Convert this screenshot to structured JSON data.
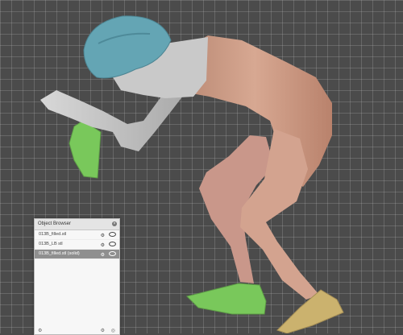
{
  "object_browser": {
    "title": "Object Browser",
    "close_glyph": "×",
    "items": [
      {
        "name": "013B_filled.stl",
        "selected": false
      },
      {
        "name": "013B_LB stl",
        "selected": false
      },
      {
        "name": "013B_filled.stl (solid)",
        "selected": true
      }
    ],
    "footer_left_glyph": "⚙",
    "footer_mid_glyph": "⚙",
    "footer_right_glyph": "◎"
  },
  "colors": {
    "helmet": "#64a5b4",
    "body_skin": "#c89a85",
    "head_arm_gray": "#c9c9c9",
    "green_parts": "#79c85b",
    "yellow_shoe": "#cbb26e",
    "viewport_bg": "#4b4b4b"
  }
}
